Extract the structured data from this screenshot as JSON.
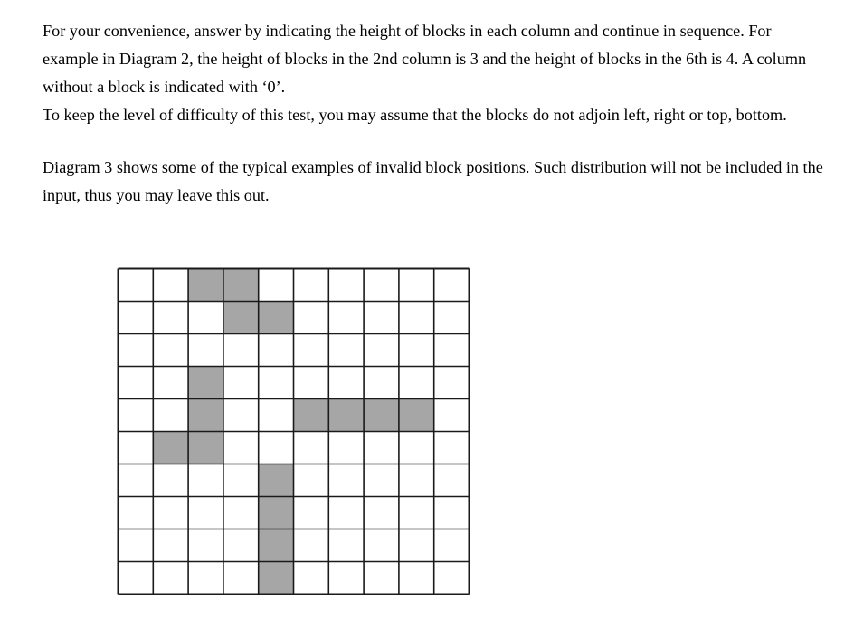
{
  "paragraphs": [
    "For your convenience, answer by indicating the height of blocks in each column and continue in sequence.  For example in Diagram 2, the height of blocks in the 2nd column is 3 and the height of blocks in the 6th is 4. A column without a block is indicated with ‘0’.",
    "To keep the level of difficulty of this test, you may assume that the blocks do not adjoin left, right or top, bottom.",
    "Diagram 3 shows some of the typical examples of invalid block positions. Such distribution will not be included in the input, thus you may leave this out."
  ],
  "figure": {
    "grid": {
      "columns": 10,
      "rows": 10
    },
    "colors": {
      "block": "#a6a6a6",
      "line": "#1a1a1a",
      "background": "#ffffff"
    },
    "blocks": [
      {
        "col": 3,
        "row": 1,
        "span_cols": 2,
        "span_rows": 1
      },
      {
        "col": 4,
        "row": 2,
        "span_cols": 2,
        "span_rows": 1
      },
      {
        "col": 3,
        "row": 4,
        "span_cols": 1,
        "span_rows": 2
      },
      {
        "col": 2,
        "row": 6,
        "span_cols": 2,
        "span_rows": 1
      },
      {
        "col": 6,
        "row": 5,
        "span_cols": 2,
        "span_rows": 1
      },
      {
        "col": 8,
        "row": 5,
        "span_cols": 2,
        "span_rows": 1
      },
      {
        "col": 5,
        "row": 7,
        "span_cols": 1,
        "span_rows": 2
      },
      {
        "col": 5,
        "row": 9,
        "span_cols": 1,
        "span_rows": 2
      }
    ]
  }
}
